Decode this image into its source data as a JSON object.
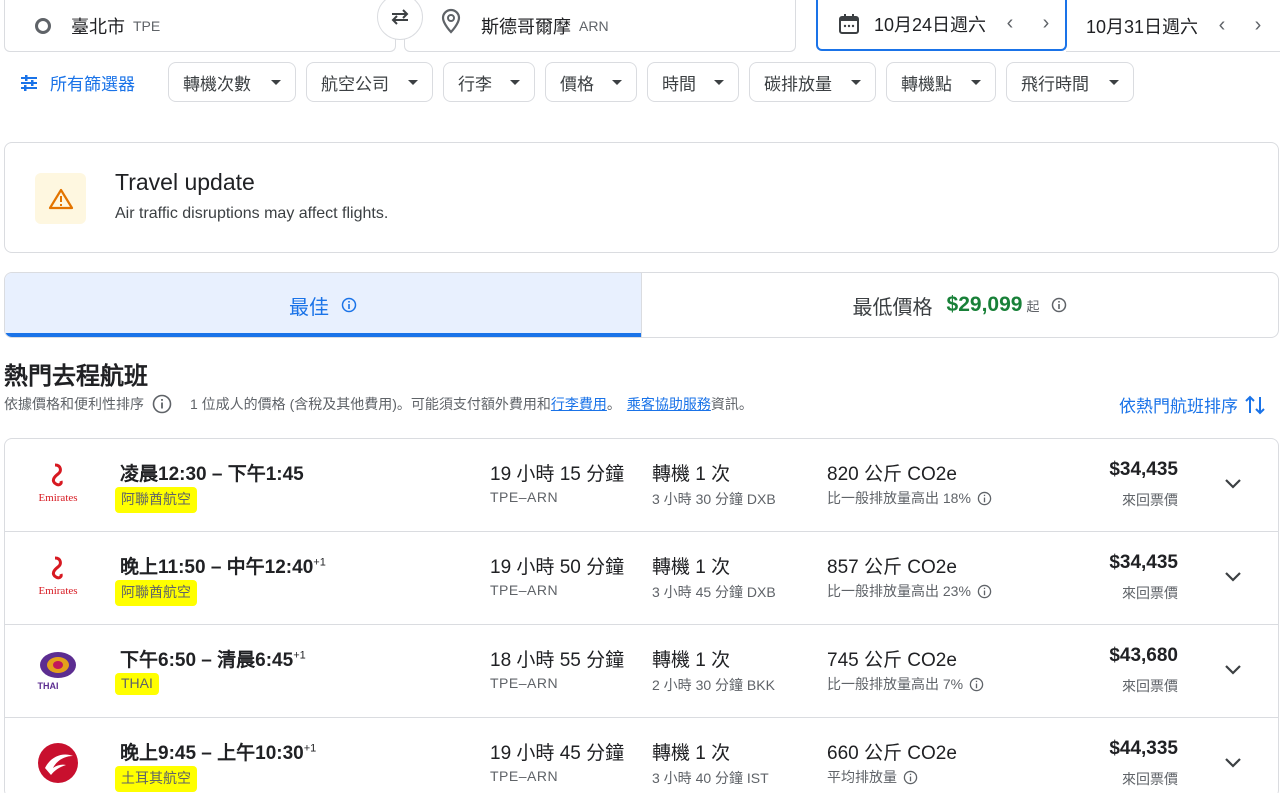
{
  "search": {
    "origin": {
      "city": "臺北市",
      "code": "TPE"
    },
    "destination": {
      "city": "斯德哥爾摩",
      "code": "ARN"
    },
    "depart_date": "10月24日週六",
    "return_date": "10月31日週六"
  },
  "filters": {
    "all_label": "所有篩選器",
    "chips": [
      "轉機次數",
      "航空公司",
      "行李",
      "價格",
      "時間",
      "碳排放量",
      "轉機點",
      "飛行時間"
    ]
  },
  "travel_update": {
    "title": "Travel update",
    "body": "Air traffic disruptions may affect flights."
  },
  "tabs": {
    "best_label": "最佳",
    "cheapest_label": "最低價格",
    "cheapest_price": "$29,099",
    "cheapest_suffix": "起"
  },
  "section": {
    "title": "熱門去程航班",
    "sort_note": "依據價格和便利性排序",
    "price_note": "1 位成人的價格 (含稅及其他費用)。可能須支付額外費用和",
    "baggage_link": "行李費用",
    "sep": "。",
    "assist_link": "乘客協助服務",
    "assist_tail": "資訊。",
    "sort_button": "依熱門航班排序"
  },
  "flights": [
    {
      "logo": "emirates",
      "times": "凌晨12:30 – 下午1:45",
      "plus": "",
      "airline": "阿聯酋航空",
      "duration": "19 小時 15 分鐘",
      "route": "TPE–ARN",
      "stops": "轉機 1 次",
      "layover": "3 小時 30 分鐘 DXB",
      "co2": "820 公斤 CO2e",
      "co2_note": "比一般排放量高出 18%",
      "price": "$34,435",
      "price_sub": "來回票價"
    },
    {
      "logo": "emirates",
      "times": "晚上11:50 – 中午12:40",
      "plus": "+1",
      "airline": "阿聯酋航空",
      "duration": "19 小時 50 分鐘",
      "route": "TPE–ARN",
      "stops": "轉機 1 次",
      "layover": "3 小時 45 分鐘 DXB",
      "co2": "857 公斤 CO2e",
      "co2_note": "比一般排放量高出 23%",
      "price": "$34,435",
      "price_sub": "來回票價"
    },
    {
      "logo": "thai",
      "times": "下午6:50 – 清晨6:45",
      "plus": "+1",
      "airline": "THAI",
      "duration": "18 小時 55 分鐘",
      "route": "TPE–ARN",
      "stops": "轉機 1 次",
      "layover": "2 小時 30 分鐘 BKK",
      "co2": "745 公斤 CO2e",
      "co2_note": "比一般排放量高出 7%",
      "price": "$43,680",
      "price_sub": "來回票價"
    },
    {
      "logo": "turkish",
      "times": "晚上9:45 – 上午10:30",
      "plus": "+1",
      "airline": "土耳其航空",
      "duration": "19 小時 45 分鐘",
      "route": "TPE–ARN",
      "stops": "轉機 1 次",
      "layover": "3 小時 40 分鐘 IST",
      "co2": "660 公斤 CO2e",
      "co2_note": "平均排放量",
      "price": "$44,335",
      "price_sub": "來回票價"
    }
  ],
  "colors": {
    "accent": "#1a73e8",
    "price_green": "#188038",
    "highlight": "#ffff00",
    "warning": "#e37400"
  }
}
